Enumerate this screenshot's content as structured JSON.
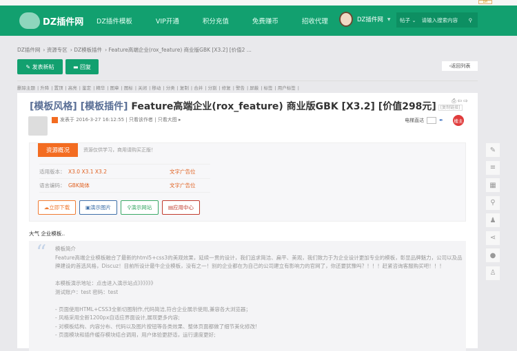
{
  "topbar": {
    "diy_label": "DIY"
  },
  "header": {
    "logo": "DZ插件网",
    "nav": [
      "DZ插件模板",
      "VIP开通",
      "积分充值",
      "免费赚币",
      "招收代理"
    ],
    "username": "DZ插件网",
    "search_type": "帖子",
    "search_placeholder": "请输入搜索内容"
  },
  "breadcrumb": [
    "DZ插件网",
    "资源专区",
    "DZ模板插件",
    "Feature高端企业(rox_feature) 商业版GBK [X3.2] [价值2 ..."
  ],
  "actions": {
    "new_post": "发表新帖",
    "reply": "回复",
    "back_list": "返回列表"
  },
  "mod_tools": [
    "删除主题",
    "升降",
    "置顶",
    "高亮",
    "鉴定",
    "精华",
    "图章",
    "图标",
    "关闭",
    "移动",
    "分类",
    "复制",
    "合并",
    "分割",
    "修复",
    "警告",
    "屏蔽",
    "标签",
    "用户标签"
  ],
  "post": {
    "tag1": "[模板风格]",
    "tag2": "[模板插件]",
    "title": "Feature高端企业(rox_feature) 商业版GBK [X3.2] [价值298元]",
    "copy_link": "[复制链接]",
    "posted": "发表于 2016-3-27 16:12:55",
    "only_author": "只看该作者",
    "only_images": "只看大图",
    "e_read": "电梯直达",
    "owner": "楼主"
  },
  "resource": {
    "tab": "资源概况",
    "note": "资源仅供学习，商用请购买正版！",
    "rows": [
      {
        "key": "适用版本：",
        "value": "X3.0 X3.1 X3.2",
        "ad": "文字广告位"
      },
      {
        "key": "语言编码：",
        "value": "GBK简体",
        "ad": "文字广告位"
      }
    ],
    "buttons": [
      {
        "label": "立即下载",
        "color": "#f07a30"
      },
      {
        "label": "演示图片",
        "color": "#3e6fa8"
      },
      {
        "label": "演示网站",
        "color": "#38a865"
      },
      {
        "label": "应用中心",
        "color": "#c0392b"
      }
    ]
  },
  "content": {
    "summary": "大气 企业模板..",
    "quote": [
      "模板简介",
      "Feature高端企业模板融合了最新的html5+css3的美观效果，延续一贯的设计，我们追求简洁、扁平、美观，我们致力于为企业设计更加专业的模板，彰显品牌魅力，公司以及品牌建设的首选风格，Discuz！目前所设计最牛企业模板，没有之一！别的企业都在为自己的公司建立有影响力的官网了，你还要犹豫吗？！！！赶紧咨询客服购买吧！！！",
      "",
      "本模板演示地址：点击进入演示站点》》》》》》",
      "测试账户：test 密码：test",
      "",
      "- 页面使用HTML+CSS3全新切图制作,代码简洁,符合企业展示使用,兼容各大浏览器；",
      "- 风格采用全新1200px自适应界面设计,展现更多内容;",
      "- 对模板结构、内容分布、代码以及图片按钮等各类效果、整体页面都做了细节美化修改!",
      "- 页面模块和插件缓存模块结合调用，用户体验更舒适，运行速度更好;"
    ]
  }
}
